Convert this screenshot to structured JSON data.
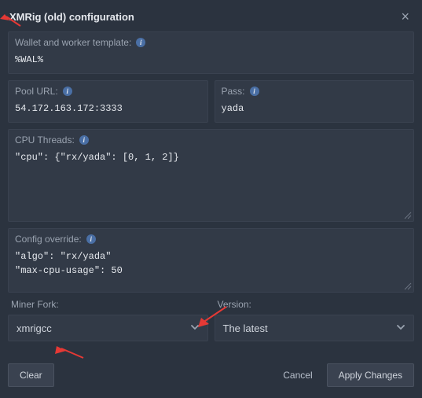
{
  "header": {
    "title": "XMRig (old) configuration",
    "close": "×"
  },
  "wallet": {
    "label": "Wallet and worker template:",
    "value": "%WAL%"
  },
  "pool": {
    "label": "Pool URL:",
    "value": "54.172.163.172:3333"
  },
  "pass": {
    "label": "Pass:",
    "value": "yada"
  },
  "cpu": {
    "label": "CPU Threads:",
    "value": "\"cpu\": {\"rx/yada\": [0, 1, 2]}"
  },
  "config": {
    "label": "Config override:",
    "value": "\"algo\": \"rx/yada\"\n\"max-cpu-usage\": 50"
  },
  "miner_fork": {
    "label": "Miner Fork:",
    "value": "xmrigcc"
  },
  "version": {
    "label": "Version:",
    "value": "The latest"
  },
  "footer": {
    "clear": "Clear",
    "cancel": "Cancel",
    "apply": "Apply Changes"
  },
  "info_glyph": "i"
}
